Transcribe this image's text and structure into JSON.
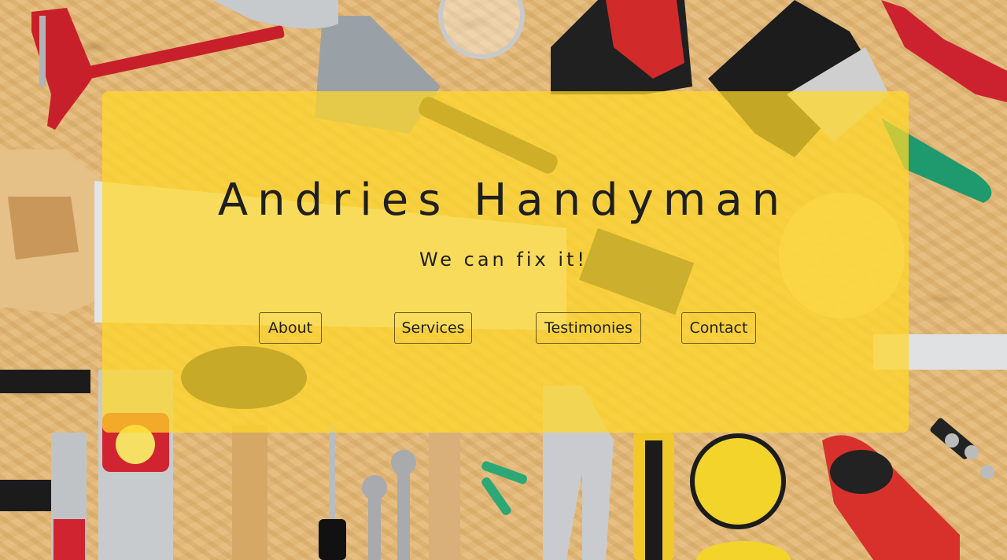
{
  "site": {
    "title": "Andries Handyman",
    "tagline": "We can fix it!"
  },
  "nav": {
    "about": "About",
    "services": "Services",
    "testimonies": "Testimonies",
    "contact": "Contact"
  },
  "colors": {
    "overlay": "#FFD828",
    "text": "#1F1F1F",
    "wood": "#E3B97A"
  }
}
